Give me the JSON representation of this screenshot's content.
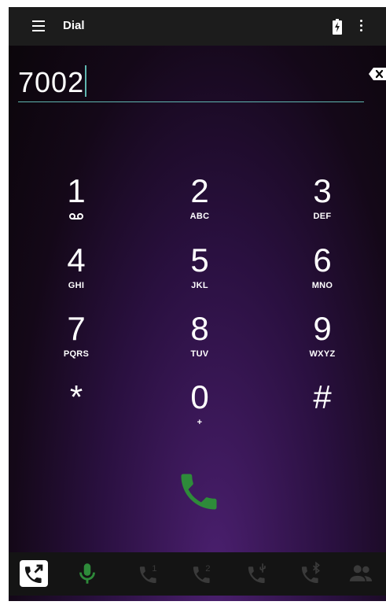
{
  "toolbar": {
    "title": "Dial",
    "menu_icon": "hamburger-menu-icon",
    "battery_icon": "battery-charging-icon",
    "overflow_icon": "overflow-menu-icon"
  },
  "dialer": {
    "number": "7002",
    "backspace_icon": "backspace-icon"
  },
  "keys": [
    {
      "digit": "1",
      "letters": "",
      "sub_icon": "voicemail-icon"
    },
    {
      "digit": "2",
      "letters": "ABC"
    },
    {
      "digit": "3",
      "letters": "DEF"
    },
    {
      "digit": "4",
      "letters": "GHI"
    },
    {
      "digit": "5",
      "letters": "JKL"
    },
    {
      "digit": "6",
      "letters": "MNO"
    },
    {
      "digit": "7",
      "letters": "PQRS"
    },
    {
      "digit": "8",
      "letters": "TUV"
    },
    {
      "digit": "9",
      "letters": "WXYZ"
    },
    {
      "digit": "*",
      "letters": ""
    },
    {
      "digit": "0",
      "letters": "+"
    },
    {
      "digit": "#",
      "letters": ""
    }
  ],
  "call_button": {
    "icon": "phone-call-icon",
    "color": "#2e8b3a"
  },
  "bottom_tabs": [
    {
      "icon": "call-transfer-icon",
      "selected": true
    },
    {
      "icon": "microphone-icon",
      "active_color": "#2e8b3a"
    },
    {
      "icon": "line1-call-icon"
    },
    {
      "icon": "line2-call-icon"
    },
    {
      "icon": "usb-call-icon"
    },
    {
      "icon": "bluetooth-call-icon"
    },
    {
      "icon": "contacts-icon"
    }
  ],
  "colors": {
    "accent": "#5fb6b0",
    "call_green": "#2e8b3a",
    "toolbar_bg": "#1c1c1c",
    "disabled_icon": "#3a3a3a"
  }
}
